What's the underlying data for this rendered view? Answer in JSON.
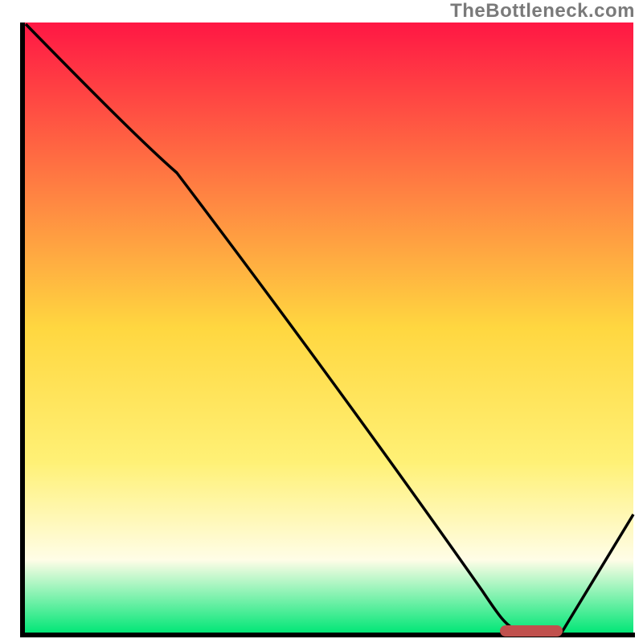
{
  "watermark": "TheBottleneck.com",
  "chart_data": {
    "type": "line",
    "title": "",
    "x": [
      0,
      10,
      20,
      30,
      40,
      50,
      60,
      70,
      80,
      85,
      100
    ],
    "values": [
      100,
      90,
      80,
      67,
      54,
      41,
      28,
      15,
      2,
      0,
      20
    ],
    "xlim": [
      0,
      100
    ],
    "ylim": [
      0,
      100
    ],
    "marker": {
      "x_start": 78,
      "x_end": 85,
      "y": 0
    },
    "background_gradient": {
      "stops": [
        {
          "offset": 0,
          "color": "#ff1744"
        },
        {
          "offset": 50,
          "color": "#ffd740"
        },
        {
          "offset": 72,
          "color": "#fff176"
        },
        {
          "offset": 88,
          "color": "#fffde7"
        },
        {
          "offset": 100,
          "color": "#00e676"
        }
      ]
    }
  }
}
